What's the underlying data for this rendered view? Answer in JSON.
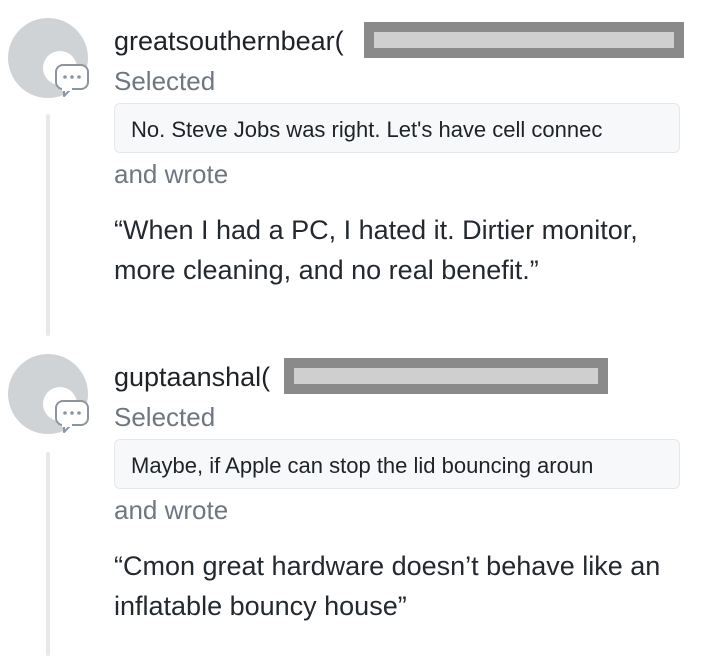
{
  "comments": [
    {
      "author": "greatsouthernbear(",
      "selected_label": "Selected",
      "quote": "No. Steve Jobs was right. Let's have cell connec",
      "wrote_label": "and wrote",
      "body": "“When I had a PC, I hated it. Dirtier monitor, more cleaning, and no real benefit.”",
      "avatar_icon": "default-avatar-icon",
      "badge_icon": "comment-bubble-icon"
    },
    {
      "author": "guptaanshal(",
      "selected_label": "Selected",
      "quote": "Maybe, if Apple can stop the lid bouncing aroun",
      "wrote_label": "and wrote",
      "body": "“Cmon great hardware doesn’t behave like an inflatable bouncy house”",
      "avatar_icon": "default-avatar-icon",
      "badge_icon": "comment-bubble-icon"
    }
  ],
  "colors": {
    "redaction_outer": "#8a8a8a",
    "redaction_inner": "#cfcfcf",
    "avatar": "#d0d3d6",
    "thread_line": "#e6e8eb"
  }
}
